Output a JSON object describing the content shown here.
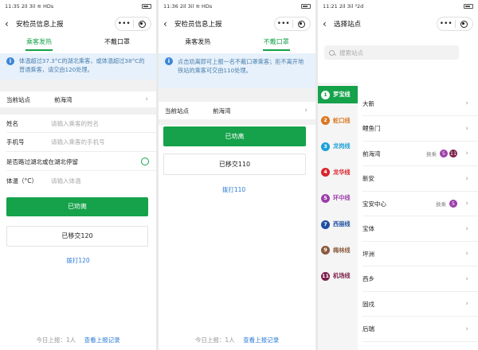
{
  "screen1": {
    "status_time": "11:35",
    "status_net": "2il 3il ≋ HDs",
    "title": "安检员信息上报",
    "tabs": [
      "乘客发热",
      "不戴口罩"
    ],
    "notice": "体温超过37.3°C的湖北乘客，或体温超过38°C的普通乘客，请交由120处理。",
    "station_label": "当前站点",
    "station_value": "前海湾",
    "name_label": "姓名",
    "name_placeholder": "请输入乘客的姓名",
    "phone_label": "手机号",
    "phone_placeholder": "请输入乘客的手机号",
    "hubei_label": "是否路过湖北或在湖北停留",
    "temp_label": "体温（°C）",
    "temp_placeholder": "请输入体温",
    "btn_leave": "已劝离",
    "btn_transfer": "已移交120",
    "call_link": "拨打120",
    "today_count": "今日上报：1人",
    "view_records": "查看上报记录"
  },
  "screen2": {
    "status_time": "11:36",
    "status_net": "2il 3il ≋ HDs",
    "title": "安检员信息上报",
    "tabs": [
      "乘客发热",
      "不戴口罩"
    ],
    "notice": "点击劝离即可上报一名不戴口罩乘客；拒不离开地铁站的乘客可交由110处理。",
    "station_label": "当前站点",
    "station_value": "前海湾",
    "btn_leave": "已劝离",
    "btn_transfer": "已移交110",
    "call_link": "拨打110",
    "today_count": "今日上报：1人",
    "view_records": "查看上报记录"
  },
  "screen3": {
    "status_time": "11:21",
    "status_net": "2il 3il ²2d",
    "title": "选择站点",
    "search_placeholder": "搜索站点",
    "lines": [
      {
        "num": "1",
        "name": "罗宝线",
        "color": "#15a24a"
      },
      {
        "num": "2",
        "name": "蛇口线",
        "color": "#d9771f"
      },
      {
        "num": "3",
        "name": "龙岗线",
        "color": "#1ea0d6"
      },
      {
        "num": "4",
        "name": "龙华线",
        "color": "#d8242a"
      },
      {
        "num": "5",
        "name": "环中线",
        "color": "#9b3fa8"
      },
      {
        "num": "7",
        "name": "西丽线",
        "color": "#1f4fa0"
      },
      {
        "num": "9",
        "name": "梅林线",
        "color": "#8b5a3c"
      },
      {
        "num": "11",
        "name": "机场线",
        "color": "#7a1f4a"
      }
    ],
    "transfer_label": "换乘",
    "stations": [
      {
        "name": "大新",
        "transfers": []
      },
      {
        "name": "鲤鱼门",
        "transfers": []
      },
      {
        "name": "前海湾",
        "transfers": [
          {
            "num": "5",
            "color": "#9b3fa8"
          },
          {
            "num": "11",
            "color": "#7a1f4a"
          }
        ]
      },
      {
        "name": "新安",
        "transfers": []
      },
      {
        "name": "宝安中心",
        "transfers": [
          {
            "num": "5",
            "color": "#9b3fa8"
          }
        ]
      },
      {
        "name": "宝体",
        "transfers": []
      },
      {
        "name": "坪洲",
        "transfers": []
      },
      {
        "name": "西乡",
        "transfers": []
      },
      {
        "name": "固戍",
        "transfers": []
      },
      {
        "name": "后瑞",
        "transfers": []
      }
    ]
  },
  "colors": {
    "accent": "#15a24a",
    "link": "#2c7bd6",
    "notice_bg": "#e7f1fb"
  },
  "icons": {
    "back": "chevron-left-icon",
    "more": "more-dots-icon",
    "close": "close-capsule-icon",
    "info": "info-icon",
    "arrow": "chevron-right-icon",
    "search": "search-icon"
  }
}
